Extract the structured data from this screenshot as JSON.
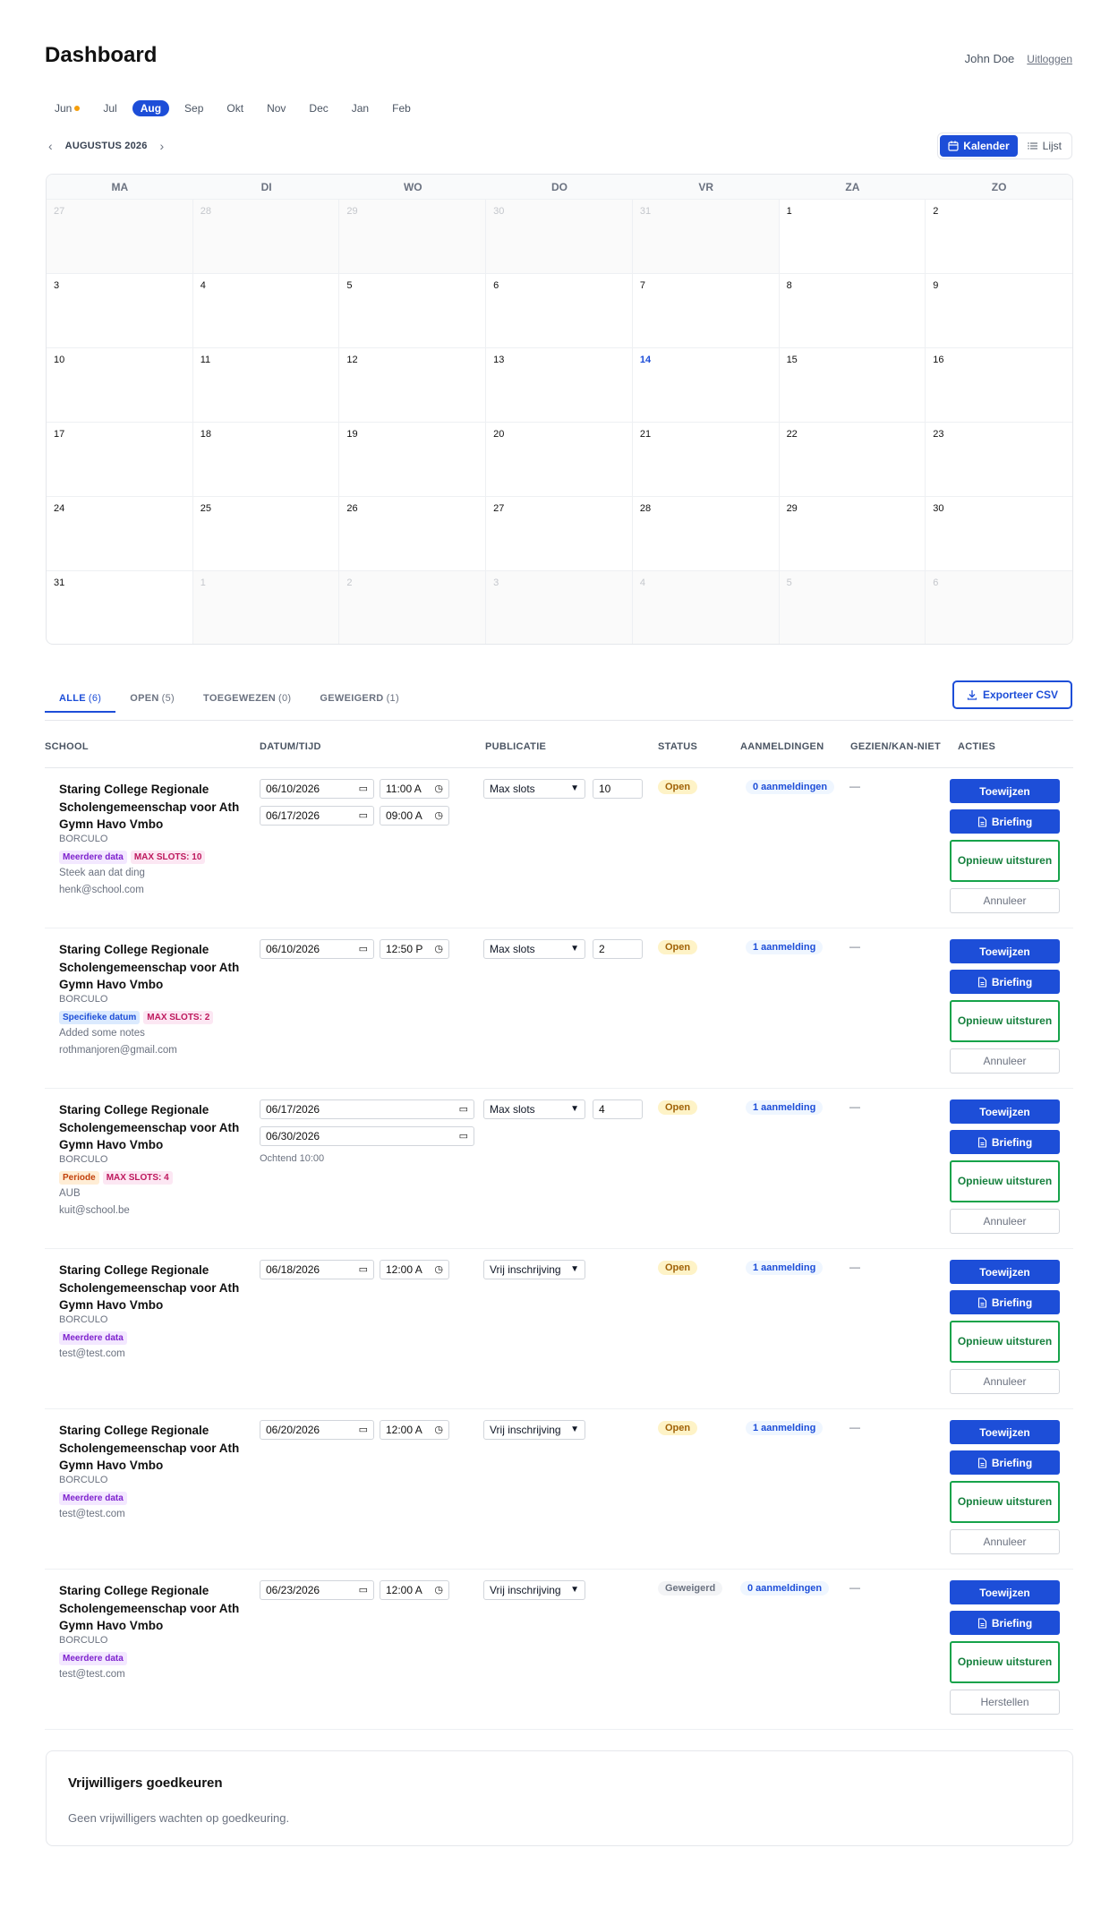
{
  "header": {
    "title": "Dashboard",
    "user": "John Doe",
    "logout": "Uitloggen"
  },
  "months": [
    "Jun",
    "Jul",
    "Aug",
    "Sep",
    "Okt",
    "Nov",
    "Dec",
    "Jan",
    "Feb"
  ],
  "active_month": "Aug",
  "calendar": {
    "label": "AUGUSTUS 2026",
    "prev": "‹",
    "next": "›",
    "view_calendar": "Kalender",
    "view_list": "Lijst",
    "weekdays": [
      "MA",
      "DI",
      "WO",
      "DO",
      "VR",
      "ZA",
      "ZO"
    ],
    "days": [
      {
        "d": "27",
        "out": true
      },
      {
        "d": "28",
        "out": true
      },
      {
        "d": "29",
        "out": true
      },
      {
        "d": "30",
        "out": true
      },
      {
        "d": "31",
        "out": true
      },
      {
        "d": "1"
      },
      {
        "d": "2"
      },
      {
        "d": "3"
      },
      {
        "d": "4"
      },
      {
        "d": "5"
      },
      {
        "d": "6"
      },
      {
        "d": "7"
      },
      {
        "d": "8"
      },
      {
        "d": "9"
      },
      {
        "d": "10"
      },
      {
        "d": "11"
      },
      {
        "d": "12"
      },
      {
        "d": "13"
      },
      {
        "d": "14",
        "today": true
      },
      {
        "d": "15"
      },
      {
        "d": "16"
      },
      {
        "d": "17"
      },
      {
        "d": "18"
      },
      {
        "d": "19"
      },
      {
        "d": "20"
      },
      {
        "d": "21"
      },
      {
        "d": "22"
      },
      {
        "d": "23"
      },
      {
        "d": "24"
      },
      {
        "d": "25"
      },
      {
        "d": "26"
      },
      {
        "d": "27"
      },
      {
        "d": "28"
      },
      {
        "d": "29"
      },
      {
        "d": "30"
      },
      {
        "d": "31"
      },
      {
        "d": "1",
        "out": true
      },
      {
        "d": "2",
        "out": true
      },
      {
        "d": "3",
        "out": true
      },
      {
        "d": "4",
        "out": true
      },
      {
        "d": "5",
        "out": true
      },
      {
        "d": "6",
        "out": true
      }
    ]
  },
  "tabs": [
    {
      "label": "ALLE",
      "count": "(6)"
    },
    {
      "label": "OPEN",
      "count": "(5)"
    },
    {
      "label": "TOEGEWEZEN",
      "count": "(0)"
    },
    {
      "label": "GEWEIGERD",
      "count": "(1)"
    }
  ],
  "export_label": "Exporteer CSV",
  "columns": {
    "school": "SCHOOL",
    "datetime": "DATUM/TIJD",
    "publication": "PUBLICATIE",
    "status": "STATUS",
    "signups": "AANMELDINGEN",
    "seen": "GEZIEN/KAN-NIET",
    "actions": "ACTIES"
  },
  "rows": [
    {
      "school": "Staring College Regionale Scholengemeenschap voor Ath Gymn Havo Vmbo",
      "city": "BORCULO",
      "badges": [
        {
          "text": "Meerdere data",
          "color": "purple"
        },
        {
          "text": "MAX SLOTS: 10",
          "color": "pink"
        }
      ],
      "note": "Steek aan dat ding",
      "email": "henk@school.com",
      "mode": "multi",
      "dates": [
        {
          "date": "06/10/2026",
          "time": "11:00 A"
        },
        {
          "date": "06/17/2026",
          "time": "09:00 A"
        }
      ],
      "publication": "Max slots",
      "slots": "10",
      "status": "Open",
      "status_type": "open",
      "signups": "0 aanmeldingen",
      "seen": "—",
      "last_action": "Annuleer"
    },
    {
      "school": "Staring College Regionale Scholengemeenschap voor Ath Gymn Havo Vmbo",
      "city": "BORCULO",
      "badges": [
        {
          "text": "Specifieke datum",
          "color": "blue"
        },
        {
          "text": "MAX SLOTS: 2",
          "color": "pink"
        }
      ],
      "note": "Added some notes",
      "email": "rothmanjoren@gmail.com",
      "mode": "multi",
      "dates": [
        {
          "date": "06/10/2026",
          "time": "12:50 P"
        }
      ],
      "publication": "Max slots",
      "slots": "2",
      "status": "Open",
      "status_type": "open",
      "signups": "1 aanmelding",
      "seen": "—",
      "last_action": "Annuleer"
    },
    {
      "school": "Staring College Regionale Scholengemeenschap voor Ath Gymn Havo Vmbo",
      "city": "BORCULO",
      "badges": [
        {
          "text": "Periode",
          "color": "orange"
        },
        {
          "text": "MAX SLOTS: 4",
          "color": "pink"
        }
      ],
      "note": "AUB",
      "email": "kuit@school.be",
      "mode": "period",
      "dates": [
        {
          "date": "06/17/2026"
        },
        {
          "date": "06/30/2026"
        }
      ],
      "period_note": "Ochtend 10:00",
      "publication": "Max slots",
      "slots": "4",
      "status": "Open",
      "status_type": "open",
      "signups": "1 aanmelding",
      "seen": "—",
      "last_action": "Annuleer"
    },
    {
      "school": "Staring College Regionale Scholengemeenschap voor Ath Gymn Havo Vmbo",
      "city": "BORCULO",
      "badges": [
        {
          "text": "Meerdere data",
          "color": "purple"
        }
      ],
      "note": "",
      "email": "test@test.com",
      "mode": "multi",
      "dates": [
        {
          "date": "06/18/2026",
          "time": "12:00 A"
        }
      ],
      "publication": "Vrij inschrijving",
      "slots": null,
      "status": "Open",
      "status_type": "open",
      "signups": "1 aanmelding",
      "seen": "—",
      "last_action": "Annuleer"
    },
    {
      "school": "Staring College Regionale Scholengemeenschap voor Ath Gymn Havo Vmbo",
      "city": "BORCULO",
      "badges": [
        {
          "text": "Meerdere data",
          "color": "purple"
        }
      ],
      "note": "",
      "email": "test@test.com",
      "mode": "multi",
      "dates": [
        {
          "date": "06/20/2026",
          "time": "12:00 A"
        }
      ],
      "publication": "Vrij inschrijving",
      "slots": null,
      "status": "Open",
      "status_type": "open",
      "signups": "1 aanmelding",
      "seen": "—",
      "last_action": "Annuleer"
    },
    {
      "school": "Staring College Regionale Scholengemeenschap voor Ath Gymn Havo Vmbo",
      "city": "BORCULO",
      "badges": [
        {
          "text": "Meerdere data",
          "color": "purple"
        }
      ],
      "note": "",
      "email": "test@test.com",
      "mode": "multi",
      "dates": [
        {
          "date": "06/23/2026",
          "time": "12:00 A"
        }
      ],
      "publication": "Vrij inschrijving",
      "slots": null,
      "status": "Geweigerd",
      "status_type": "ref",
      "signups": "0 aanmeldingen",
      "seen": "—",
      "last_action": "Herstellen"
    }
  ],
  "actions": {
    "assign": "Toewijzen",
    "briefing": "Briefing",
    "resend": "Opnieuw uitsturen"
  },
  "volunteers": {
    "title": "Vrijwilligers goedkeuren",
    "empty": "Geen vrijwilligers wachten op goedkeuring."
  },
  "colors": {
    "accent": "#1d4ed8",
    "green": "#16a34a",
    "pending_dot": "#f59e0b"
  }
}
